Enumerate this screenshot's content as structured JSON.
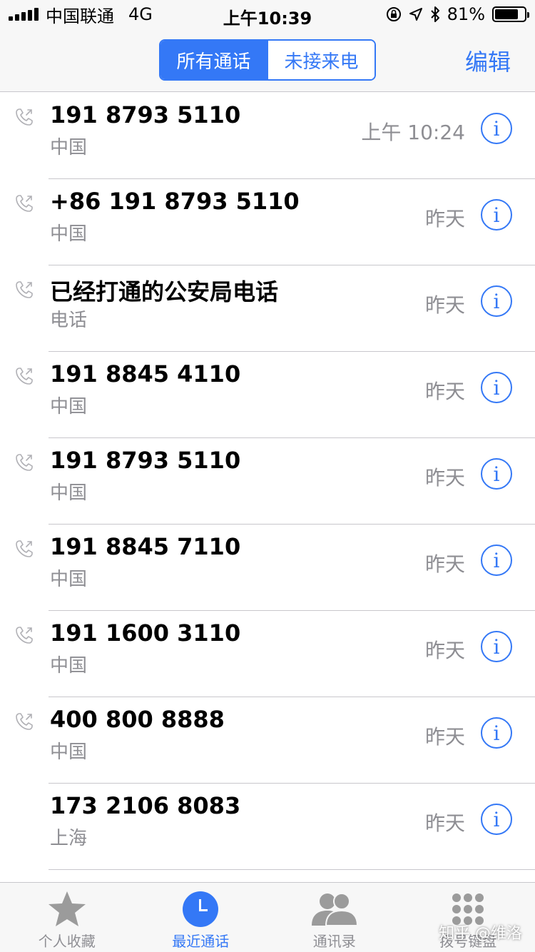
{
  "status_bar": {
    "carrier": "中国联通",
    "network": "4G",
    "time": "上午10:39",
    "battery_percent": "81%",
    "battery_level": 0.81,
    "icons": [
      "orientation-lock-icon",
      "location-icon",
      "bluetooth-icon"
    ]
  },
  "nav": {
    "segments": [
      "所有通话",
      "未接来电"
    ],
    "selected_segment": 0,
    "edit_label": "编辑"
  },
  "calls": [
    {
      "name": "191 8793 5110",
      "sub": "中国",
      "time": "上午 10:24",
      "icon": "outgoing-call-icon"
    },
    {
      "name": "+86 191 8793 5110",
      "sub": "中国",
      "time": "昨天",
      "icon": "outgoing-call-icon"
    },
    {
      "name": "已经打通的公安局电话",
      "sub": "电话",
      "time": "昨天",
      "icon": "outgoing-call-icon"
    },
    {
      "name": "191 8845 4110",
      "sub": "中国",
      "time": "昨天",
      "icon": "outgoing-call-icon"
    },
    {
      "name": "191 8793 5110",
      "sub": "中国",
      "time": "昨天",
      "icon": "outgoing-call-icon"
    },
    {
      "name": "191 8845 7110",
      "sub": "中国",
      "time": "昨天",
      "icon": "outgoing-call-icon"
    },
    {
      "name": "191 1600 3110",
      "sub": "中国",
      "time": "昨天",
      "icon": "outgoing-call-icon"
    },
    {
      "name": "400 800 8888",
      "sub": "中国",
      "time": "昨天",
      "icon": "outgoing-call-icon"
    },
    {
      "name": "173 2106 8083",
      "sub": "上海",
      "time": "昨天",
      "icon": ""
    }
  ],
  "info_glyph": "i",
  "tabs": [
    {
      "label": "个人收藏",
      "icon": "star-icon"
    },
    {
      "label": "最近通话",
      "icon": "clock-icon"
    },
    {
      "label": "通讯录",
      "icon": "contacts-icon"
    },
    {
      "label": "拨号键盘",
      "icon": "keypad-icon"
    }
  ],
  "active_tab": 1,
  "watermark": "知乎 @维洛",
  "colors": {
    "accent": "#3478f6",
    "secondary_text": "#8e8e93",
    "separator": "#c8c7cc"
  }
}
